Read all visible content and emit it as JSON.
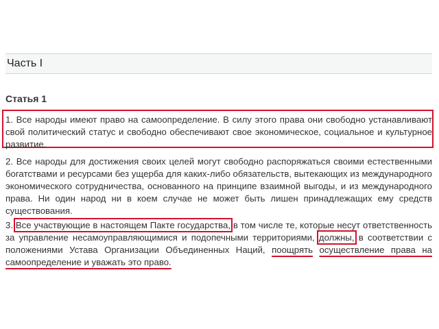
{
  "section": {
    "title": "Часть I"
  },
  "article": {
    "title": "Статья 1"
  },
  "paragraphs": {
    "p1": "1. Все народы имеют право на самоопределение. В силу этого права они свободно устанавливают свой политический статус и свободно обеспечивают свое экономическое, социальное и культурное развитие.",
    "p2": "2. Все народы для достижения своих целей могут свободно распоряжаться своими естественными богатствами и ресурсами без ущерба для каких-либо обязательств, вытекающих из международного экономического сотрудничества, основанного на принципе взаимной выгоды, и из международного права. Ни один народ ни в коем случае не может быть лишен принадлежащих ему средств существования.",
    "p3": {
      "num": "3. ",
      "boxed_1": "Все участвующие в настоящем Пакте государства,",
      "text_1": " в том числе те, которые несут ответственность за управление несамоуправляющимися и подопечными территориями, ",
      "boxed_2": "должны,",
      "text_2": " в соответствии с положениями Устава Организации Объединенных Наций, ",
      "underlined_1": "поощрять",
      "text_3": " ",
      "underlined_2": "осуществление права на самоопределение и уважать это право."
    }
  },
  "colors": {
    "highlight": "#d4102c",
    "text": "#333333",
    "header_background": "#f5f7f6"
  }
}
